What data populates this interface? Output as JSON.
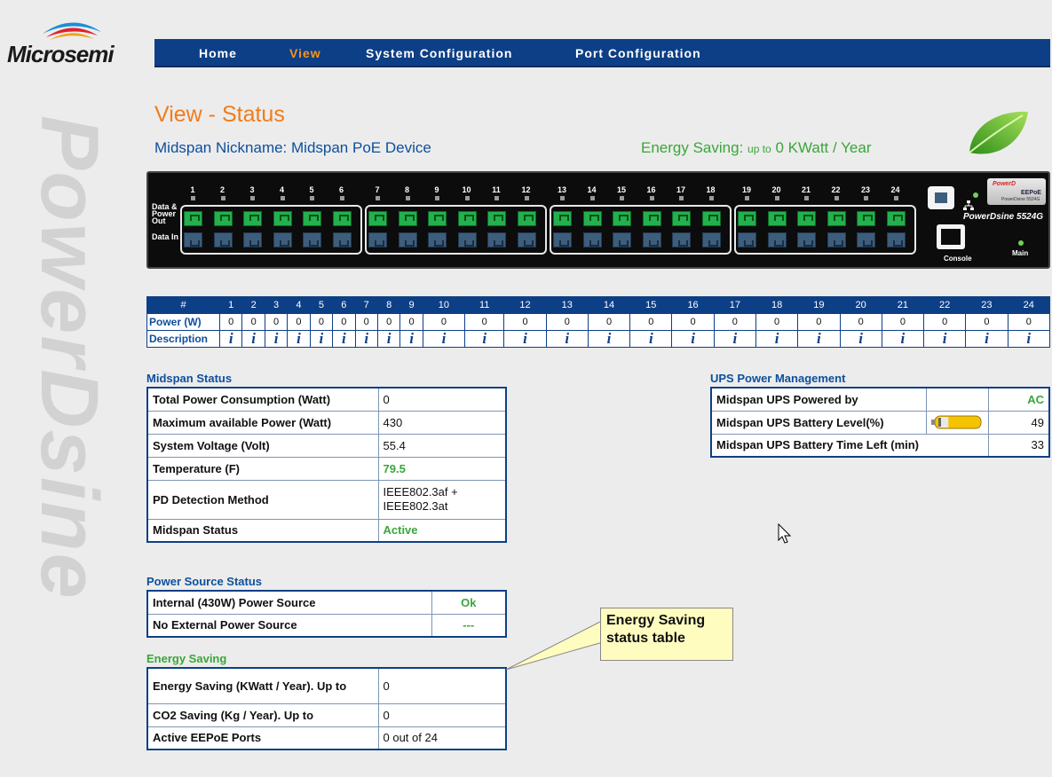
{
  "logo": {
    "text": "Microsemi"
  },
  "brand_watermark": "PowerDsine",
  "nav": [
    {
      "label": "Home",
      "active": false
    },
    {
      "label": "View",
      "active": true
    },
    {
      "label": "System Configuration",
      "active": false
    },
    {
      "label": "Port Configuration",
      "active": false
    }
  ],
  "page": {
    "title": "View - Status",
    "nickname": "Midspan Nickname: Midspan PoE Device",
    "energy_prefix": "Energy Saving: ",
    "energy_small": "up to",
    "energy_value": " 0 KWatt / Year"
  },
  "device": {
    "label_data_power": "Data & Power Out",
    "label_data_in": "Data In",
    "console_label": "Console",
    "main_label": "Main",
    "model": "PowerDsine 5524G",
    "badge_top": "PowerD",
    "badge_mid": "EEPoE",
    "badge_bottom": "PowerDsine 5524G",
    "ports": [
      "1",
      "2",
      "3",
      "4",
      "5",
      "6",
      "7",
      "8",
      "9",
      "10",
      "11",
      "12",
      "13",
      "14",
      "15",
      "16",
      "17",
      "18",
      "19",
      "20",
      "21",
      "22",
      "23",
      "24"
    ]
  },
  "port_table": {
    "header_hash": "#",
    "row_power": "Power (W)",
    "row_description": "Description",
    "ports": [
      "1",
      "2",
      "3",
      "4",
      "5",
      "6",
      "7",
      "8",
      "9",
      "10",
      "11",
      "12",
      "13",
      "14",
      "15",
      "16",
      "17",
      "18",
      "19",
      "20",
      "21",
      "22",
      "23",
      "24"
    ],
    "power": [
      "0",
      "0",
      "0",
      "0",
      "0",
      "0",
      "0",
      "0",
      "0",
      "0",
      "0",
      "0",
      "0",
      "0",
      "0",
      "0",
      "0",
      "0",
      "0",
      "0",
      "0",
      "0",
      "0",
      "0"
    ],
    "info_glyph": "i"
  },
  "midspan_status": {
    "title": "Midspan Status",
    "rows": [
      {
        "label": "Total Power Consumption (Watt)",
        "value": "0"
      },
      {
        "label": "Maximum available Power (Watt)",
        "value": "430"
      },
      {
        "label": "System Voltage (Volt)",
        "value": "55.4"
      },
      {
        "label": "Temperature (F)",
        "value": "79.5"
      },
      {
        "label": "PD Detection Method",
        "value": "IEEE802.3af + IEEE802.3at"
      },
      {
        "label": "Midspan Status",
        "value": "Active"
      }
    ]
  },
  "ups": {
    "title": "UPS Power Management",
    "rows": [
      {
        "label": "Midspan UPS Powered by",
        "value": "AC"
      },
      {
        "label": "Midspan UPS Battery Level(%)",
        "value": "49",
        "battery_fraction": 0.49
      },
      {
        "label": "Midspan UPS Battery Time Left (min)",
        "value": "33"
      }
    ]
  },
  "power_source": {
    "title": "Power Source Status",
    "rows": [
      {
        "label": "Internal (430W) Power Source",
        "value": "Ok"
      },
      {
        "label": "No External Power Source",
        "value": "---"
      }
    ]
  },
  "energy_saving": {
    "title": "Energy Saving",
    "rows": [
      {
        "label": "Energy Saving (KWatt / Year). Up to",
        "value": "0"
      },
      {
        "label": "CO2 Saving (Kg / Year). Up to",
        "value": "0"
      },
      {
        "label": "Active EEPoE Ports",
        "value": "0 out of 24"
      }
    ]
  },
  "callout": {
    "line1": "Energy Saving",
    "line2": "status table"
  },
  "colors": {
    "nav_bg": "#0d3f86",
    "nav_active": "#f7941d",
    "title": "#f07c19",
    "heading_blue": "#0d4f9c",
    "ok_green": "#3aa63a",
    "battery_fill": "#f5c400"
  }
}
